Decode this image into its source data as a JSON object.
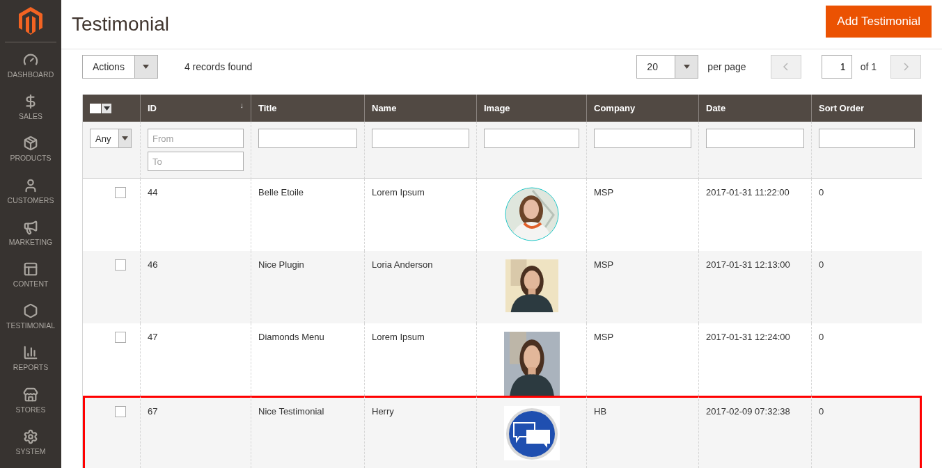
{
  "sidebar": {
    "items": [
      {
        "label": "DASHBOARD",
        "kind": "gauge"
      },
      {
        "label": "SALES",
        "kind": "dollar"
      },
      {
        "label": "PRODUCTS",
        "kind": "box"
      },
      {
        "label": "CUSTOMERS",
        "kind": "person"
      },
      {
        "label": "MARKETING",
        "kind": "megaphone"
      },
      {
        "label": "CONTENT",
        "kind": "layout"
      },
      {
        "label": "TESTIMONIAL",
        "kind": "hexagon"
      },
      {
        "label": "REPORTS",
        "kind": "chart"
      },
      {
        "label": "STORES",
        "kind": "store"
      },
      {
        "label": "SYSTEM",
        "kind": "gear"
      }
    ]
  },
  "header": {
    "title": "Testimonial",
    "button": "Add Testimonial"
  },
  "toolbar": {
    "actions": "Actions",
    "records": "4 records found",
    "per_page_value": "20",
    "per_page_label": "per page",
    "page": "1",
    "page_total": "of 1",
    "prev_disabled": true,
    "next_disabled": true
  },
  "table": {
    "columns": [
      {
        "label": "ID",
        "sort_mark": "↓"
      },
      {
        "label": "Title"
      },
      {
        "label": "Name"
      },
      {
        "label": "Image"
      },
      {
        "label": "Company"
      },
      {
        "label": "Date"
      },
      {
        "label": "Sort Order"
      }
    ],
    "filters": {
      "select": "Any",
      "id_from": {
        "placeholder": "From"
      },
      "id_to": {
        "placeholder": "To"
      }
    },
    "rows": [
      {
        "checked": false,
        "highlighted": false,
        "id": "44",
        "title": "Belle Etoile",
        "name": "Lorem Ipsum",
        "company": "MSP",
        "date": "2017-01-31 11:22:00",
        "sort": "0"
      },
      {
        "checked": false,
        "highlighted": false,
        "id": "46",
        "title": "Nice Plugin",
        "name": "Loria Anderson",
        "company": "MSP",
        "date": "2017-01-31 12:13:00",
        "sort": "0"
      },
      {
        "checked": false,
        "highlighted": false,
        "id": "47",
        "title": "Diamonds Menu",
        "name": "Lorem Ipsum",
        "company": "MSP",
        "date": "2017-01-31 12:24:00",
        "sort": "0"
      },
      {
        "checked": false,
        "highlighted": true,
        "id": "67",
        "title": "Nice Testimonial",
        "name": "Herry",
        "image": {
          "kind": "icon"
        },
        "company": "HB",
        "date": "2017-02-09 07:32:38",
        "sort": "0"
      }
    ]
  }
}
